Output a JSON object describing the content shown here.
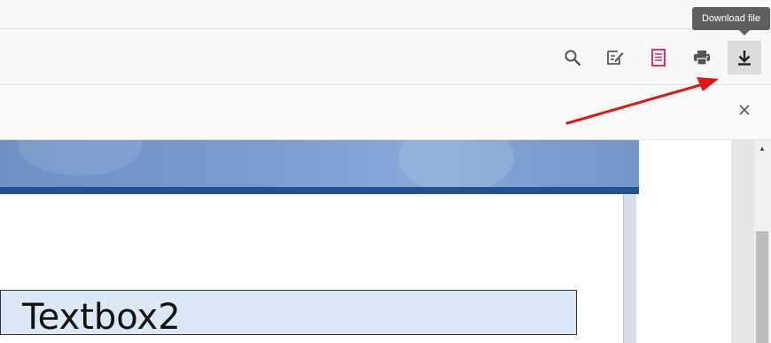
{
  "toolbar": {
    "buttons": [
      {
        "icon": "search-icon",
        "label": "Search"
      },
      {
        "icon": "annotate-icon",
        "label": "Annotate"
      },
      {
        "icon": "document-icon",
        "label": "Document"
      },
      {
        "icon": "print-icon",
        "label": "Print"
      },
      {
        "icon": "download-icon",
        "label": "Download file",
        "active": true
      }
    ],
    "tooltip": "Download file"
  },
  "secondbar": {
    "close_icon": "close-icon"
  },
  "document": {
    "textbox_label": "Textbox2"
  },
  "annotation": {
    "arrow_color": "#e0161a"
  },
  "colors": {
    "banner_blue": "#7a9cce",
    "banner_rule": "#24518f",
    "textbox_fill": "#dbe8f5",
    "tooltip_bg": "#5f5f5f"
  }
}
